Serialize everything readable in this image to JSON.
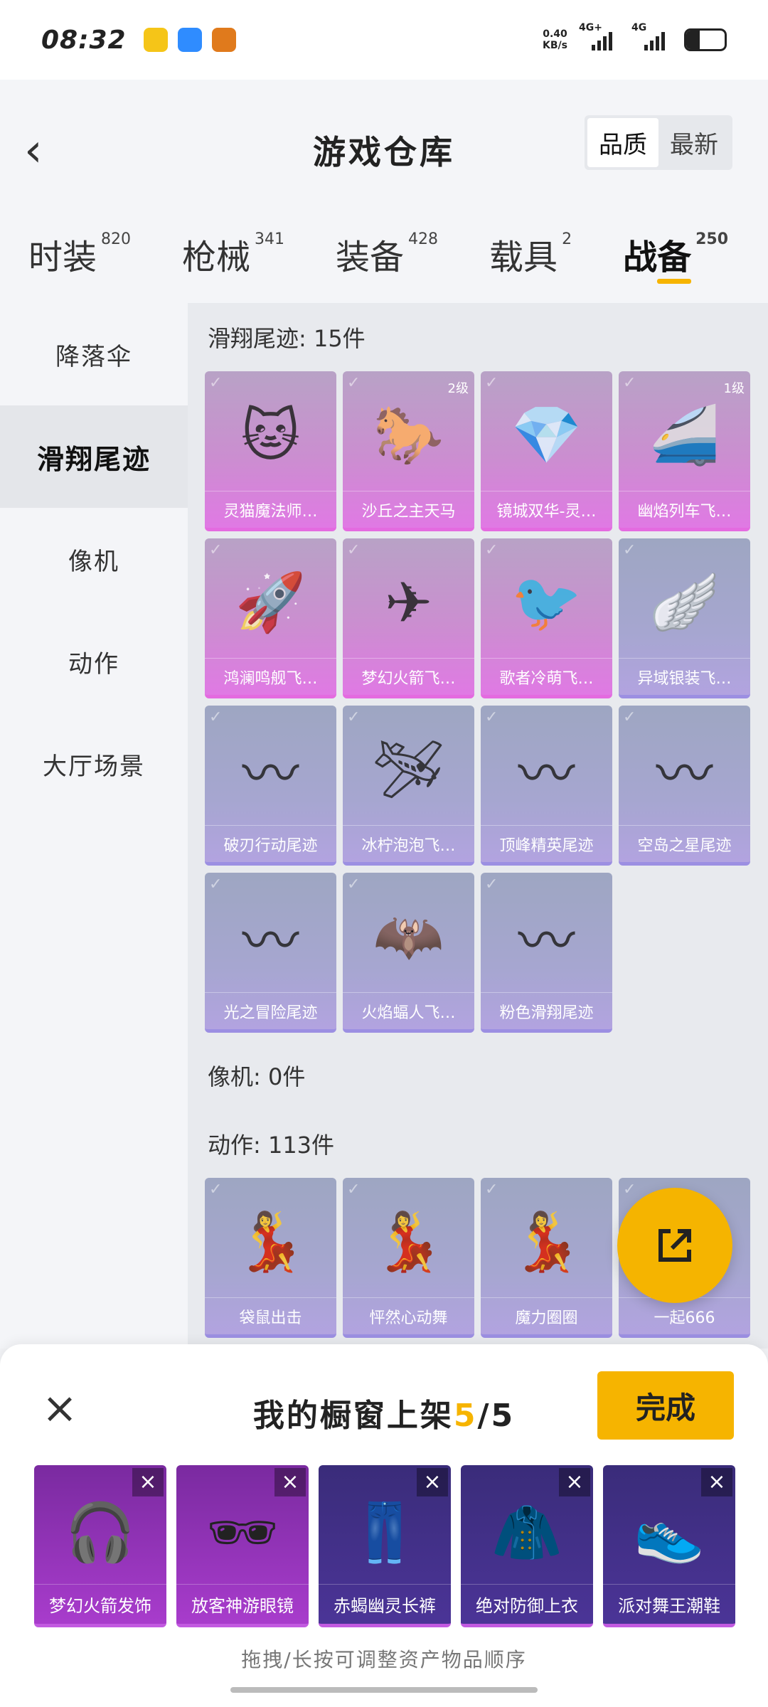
{
  "status_bar": {
    "time": "08:32",
    "net_speed_value": "0.40",
    "net_speed_unit": "KB/s",
    "signal1_label": "4G+",
    "signal2_label": "4G",
    "battery_level": 0.35,
    "apps": [
      {
        "icon": "yellow-app-icon",
        "color": "#f5c518",
        "label": "团团"
      },
      {
        "icon": "blue-app-icon",
        "color": "#2f8cff",
        "label": ""
      },
      {
        "icon": "orange-app-icon",
        "color": "#e07a1c",
        "label": "和平精英"
      }
    ]
  },
  "header": {
    "title": "游戏仓库",
    "sort_options": [
      "品质",
      "最新"
    ],
    "sort_active": "品质"
  },
  "categories": [
    {
      "label": "时装",
      "count": "820"
    },
    {
      "label": "枪械",
      "count": "341"
    },
    {
      "label": "装备",
      "count": "428"
    },
    {
      "label": "载具",
      "count": "2"
    },
    {
      "label": "战备",
      "count": "250",
      "active": true
    }
  ],
  "sidebar": {
    "items": [
      "降落伞",
      "滑翔尾迹",
      "像机",
      "动作",
      "大厅场景"
    ],
    "active_index": 1
  },
  "content": {
    "sections": [
      {
        "title": "滑翔尾迹: 15件",
        "items": [
          {
            "name": "灵猫魔法师…",
            "color": "pink",
            "icon": "cat-icon",
            "level": ""
          },
          {
            "name": "沙丘之主天马",
            "color": "pink",
            "icon": "pegasus-icon",
            "level": "2级"
          },
          {
            "name": "镜城双华-灵…",
            "color": "pink",
            "icon": "crystal-icon",
            "level": ""
          },
          {
            "name": "幽焰列车飞…",
            "color": "pink",
            "icon": "train-icon",
            "level": "1级"
          },
          {
            "name": "鸿澜鸣舰飞…",
            "color": "pink",
            "icon": "ship-icon",
            "level": ""
          },
          {
            "name": "梦幻火箭飞…",
            "color": "pink",
            "icon": "rocket-icon",
            "level": ""
          },
          {
            "name": "歌者冷萌飞…",
            "color": "pink",
            "icon": "bird-icon",
            "level": ""
          },
          {
            "name": "异域银装飞…",
            "color": "blue",
            "icon": "wing-icon",
            "level": ""
          },
          {
            "name": "破刃行动尾迹",
            "color": "blue",
            "icon": "smoke-trail-icon",
            "level": ""
          },
          {
            "name": "冰柠泡泡飞…",
            "color": "blue",
            "icon": "plane-icon",
            "level": ""
          },
          {
            "name": "顶峰精英尾迹",
            "color": "blue",
            "icon": "smoke-trail-icon",
            "level": ""
          },
          {
            "name": "空岛之星尾迹",
            "color": "blue",
            "icon": "smoke-trail-icon",
            "level": ""
          },
          {
            "name": "光之冒险尾迹",
            "color": "blue",
            "icon": "smoke-trail-icon",
            "level": ""
          },
          {
            "name": "火焰蝠人飞…",
            "color": "blue",
            "icon": "bat-icon",
            "level": ""
          },
          {
            "name": "粉色滑翔尾迹",
            "color": "blue",
            "icon": "smoke-trail-icon",
            "level": ""
          }
        ]
      },
      {
        "title": "像机: 0件",
        "items": []
      },
      {
        "title": "动作: 113件",
        "items": [
          {
            "name": "袋鼠出击",
            "color": "blue",
            "icon": "dance-icon",
            "level": ""
          },
          {
            "name": "怦然心动舞",
            "color": "blue",
            "icon": "dance-icon",
            "level": ""
          },
          {
            "name": "魔力圈圈",
            "color": "blue",
            "icon": "dance-icon",
            "level": ""
          },
          {
            "name": "一起666",
            "color": "blue",
            "icon": "dance-icon",
            "level": ""
          }
        ]
      }
    ]
  },
  "fab": {
    "icon": "share-external-icon"
  },
  "panel": {
    "title_prefix": "我的橱窗上架",
    "count_current": "5",
    "count_total": "/5",
    "done_label": "完成",
    "hint": "拖拽/长按可调整资产物品顺序",
    "slots": [
      {
        "name": "梦幻火箭发饰",
        "style": "magenta",
        "icon": "headphones-icon"
      },
      {
        "name": "放客神游眼镜",
        "style": "magenta",
        "icon": "visor-icon"
      },
      {
        "name": "赤蝎幽灵长裤",
        "style": "indigo",
        "icon": "pants-icon"
      },
      {
        "name": "绝对防御上衣",
        "style": "indigo",
        "icon": "jacket-icon"
      },
      {
        "name": "派对舞王潮鞋",
        "style": "indigo",
        "icon": "shoes-icon"
      }
    ]
  }
}
